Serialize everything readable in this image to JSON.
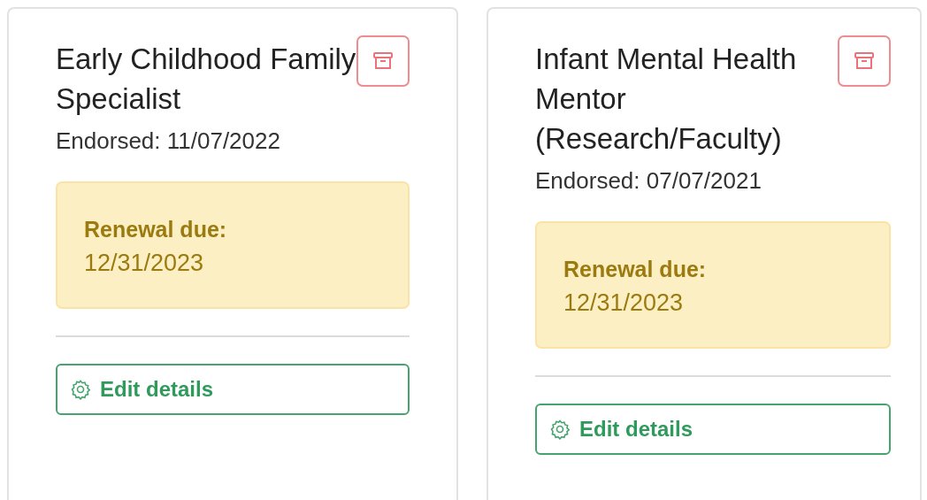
{
  "cards": [
    {
      "title": "Early Childhood Family Specialist",
      "endorsed": "Endorsed: 11/07/2022",
      "renewal_label": "Renewal due:",
      "renewal_date": "12/31/2023",
      "edit_button": "Edit details"
    },
    {
      "title": "Infant Mental Health Mentor (Research/Faculty)",
      "endorsed": "Endorsed: 07/07/2021",
      "renewal_label": "Renewal due:",
      "renewal_date": "12/31/2023",
      "edit_button": "Edit details"
    }
  ]
}
